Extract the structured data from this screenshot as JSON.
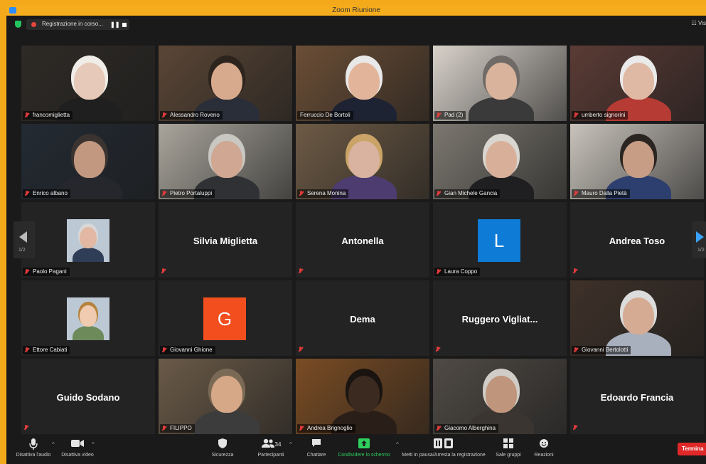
{
  "window": {
    "title": "Zoom Riunione"
  },
  "topbar": {
    "recording_label": "Registrazione in corso...",
    "pause_glyph": "❚❚",
    "view_label": "☷ Vis"
  },
  "pager": {
    "left_page": "1/2",
    "right_page": "1/2"
  },
  "tiles": [
    {
      "name": "francomiglietta",
      "type": "video",
      "muted": true,
      "bg": "#2e2a26",
      "face": "#e6c9b8",
      "hair": "#f0ede8",
      "shirt": "#1f1f1f"
    },
    {
      "name": "Alessandro Roveno",
      "type": "video",
      "muted": true,
      "bg": "#5a4636",
      "face": "#d8aa8d",
      "hair": "#2d241d",
      "shirt": "#2a2e38"
    },
    {
      "name": "Ferruccio De Bortoli",
      "type": "video",
      "muted": false,
      "active": true,
      "bg": "#6b4e36",
      "face": "#e2b59a",
      "hair": "#e8e8e8",
      "shirt": "#1e2333"
    },
    {
      "name": "Pad (2)",
      "type": "video",
      "muted": true,
      "bg": "#d8d2ca",
      "face": "#d9b39c",
      "hair": "#6f6a66",
      "shirt": "#3a3a3a"
    },
    {
      "name": "umberto signorini",
      "type": "video",
      "muted": true,
      "bg": "#5b3b35",
      "face": "#e0b9a4",
      "hair": "#eaeaea",
      "shirt": "#b63b35"
    },
    {
      "name": "Enrico albano",
      "type": "video",
      "muted": true,
      "bg": "#232a33",
      "face": "#c29880",
      "hair": "#3a3330",
      "shirt": "#25272c"
    },
    {
      "name": "Pietro Portaluppi",
      "type": "video",
      "muted": true,
      "bg": "#a9a59c",
      "face": "#cfa792",
      "hair": "#c9c7c2",
      "shirt": "#2f3134"
    },
    {
      "name": "Serena Monina",
      "type": "video",
      "muted": true,
      "bg": "#6d5a45",
      "face": "#d9b39f",
      "hair": "#caa467",
      "shirt": "#4d3c70"
    },
    {
      "name": "Gian Michele Gancia",
      "type": "video",
      "muted": true,
      "bg": "#7c7870",
      "face": "#d8b09a",
      "hair": "#d9d6d0",
      "shirt": "#1f1f22"
    },
    {
      "name": "Mauro Dalla Pietà",
      "type": "video",
      "muted": true,
      "bg": "#c8c3bb",
      "face": "#c79e85",
      "hair": "#2b2522",
      "shirt": "#2c3f6e"
    },
    {
      "name": "Paolo Pagani",
      "type": "thumb",
      "muted": true,
      "face": "#e2b8a2",
      "hair": "#d8d8d8",
      "shirt": "#2f3d57"
    },
    {
      "name": "Silvia Miglietta",
      "type": "name",
      "muted": true
    },
    {
      "name": "Antonella",
      "type": "name",
      "muted": true
    },
    {
      "name": "Laura Coppo",
      "type": "avatar",
      "letter": "L",
      "color": "#0e7bd6",
      "muted": true
    },
    {
      "name": "Andrea Toso",
      "type": "name",
      "muted": true
    },
    {
      "name": "Ettore Cabiati",
      "type": "thumb",
      "muted": true,
      "face": "#f0cbb0",
      "hair": "#b5833c",
      "shirt": "#6c8a5a"
    },
    {
      "name": "Giovanni Ghione",
      "type": "avatar",
      "letter": "G",
      "color": "#f24e1e",
      "muted": true
    },
    {
      "name": "Dema",
      "type": "name",
      "muted": true
    },
    {
      "name": "Ruggero  Vigliat...",
      "type": "name",
      "muted": true
    },
    {
      "name": "Giovanni Bertolotti",
      "type": "video",
      "muted": true,
      "bg": "#3e3129",
      "face": "#d5ab94",
      "hair": "#dcdcdc",
      "shirt": "#a8b0bd"
    },
    {
      "name": "Guido Sodano",
      "type": "name",
      "muted": true
    },
    {
      "name": "FILIPPO",
      "type": "video",
      "muted": true,
      "bg": "#6a5a48",
      "face": "#d6a888",
      "hair": "#7a6a55",
      "shirt": "#3c3c3c"
    },
    {
      "name": "Andrea Brignoglio",
      "type": "video",
      "muted": true,
      "bg": "#7a4c24",
      "face": "#3a2a20",
      "hair": "#1a1410",
      "shirt": "#2a1e18"
    },
    {
      "name": "Giacomo Alberghina",
      "type": "video",
      "muted": true,
      "bg": "#4f4a45",
      "face": "#bf957c",
      "hair": "#d0ccc6",
      "shirt": "#3a3530"
    },
    {
      "name": "Edoardo Francia",
      "type": "name",
      "muted": true
    }
  ],
  "toolbar": {
    "audio": "Disattiva l'audio",
    "video": "Disattiva video",
    "security": "Sicurezza",
    "participants": "Partecipanti",
    "participants_count": "34",
    "chat": "Chattare",
    "share": "Condividere lo schermo",
    "record": "Metti in pausa/Arresta la registrazione",
    "breakout": "Sale gruppi",
    "reactions": "Reazioni",
    "end": "Termina"
  },
  "icons": {
    "mic": "🎤",
    "camera": "■◀",
    "shield": "⛨",
    "people": "👥",
    "chat": "💬",
    "share": "⬆",
    "record": "❚❚■",
    "grid": "▦",
    "smile": "☺",
    "caret": "^"
  },
  "colors": {
    "accent": "#2d8cff",
    "active_border": "#c8e36a",
    "muted_red": "#e03b3b",
    "share_green": "#2fd05e",
    "end_red": "#e02828"
  }
}
